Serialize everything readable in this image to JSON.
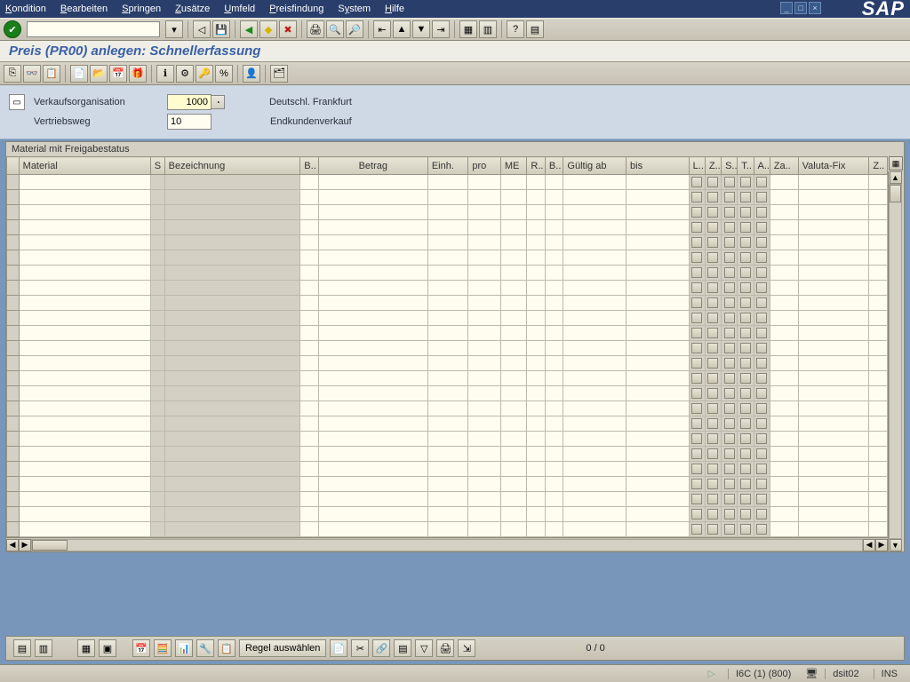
{
  "menu": [
    "Kondition",
    "Bearbeiten",
    "Springen",
    "Zusätze",
    "Umfeld",
    "Preisfindung",
    "System",
    "Hilfe"
  ],
  "brand": "SAP",
  "title": "Preis  (PR00)  anlegen: Schnellerfassung",
  "header": {
    "org_label": "Verkaufsorganisation",
    "org_value": "1000",
    "org_desc": "Deutschl. Frankfurt",
    "channel_label": "Vertriebsweg",
    "channel_value": "10",
    "channel_desc": "Endkundenverkauf"
  },
  "table": {
    "title": "Material mit Freigabestatus",
    "columns": [
      "Material",
      "S",
      "Bezeichnung",
      "B..",
      "Betrag",
      "Einh.",
      "pro",
      "ME",
      "R..",
      "B..",
      "Gültig ab",
      "bis",
      "L..",
      "Z..",
      "S..",
      "T..",
      "A..",
      "Za..",
      "Valuta-Fix",
      "Z.."
    ],
    "rows": 24
  },
  "footer": {
    "rule_button": "Regel auswählen",
    "counter": "0  /  0"
  },
  "status": {
    "system": "I6C (1) (800)",
    "host": "dsit02",
    "mode": "INS"
  }
}
